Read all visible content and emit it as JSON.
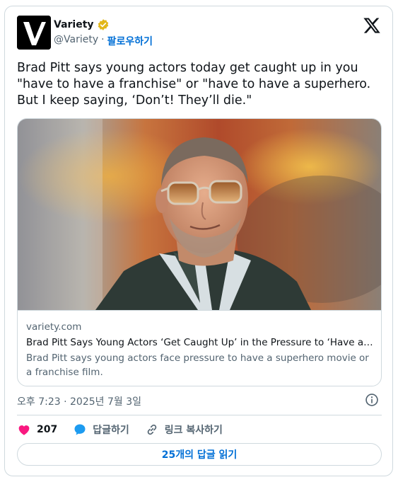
{
  "author": {
    "display_name": "Variety",
    "handle": "@Variety",
    "separator": "·",
    "follow_label": "팔로우하기",
    "avatar_icon": "variety-logo-icon",
    "verified_color": "#e2b719"
  },
  "tweet": {
    "text": "Brad Pitt says young actors today get caught up in you\n\"have to have a franchise\" or \"have to have a superhero.\nBut I keep saying, ‘Don’t! They’ll die.\""
  },
  "link_card": {
    "image_icon": "photo-brad-pitt",
    "domain": "variety.com",
    "title": "Brad Pitt Says Young Actors ‘Get Caught Up’ in the Pressure to ‘Have a Superhero Movie’ or a Franchise Film",
    "description": "Brad Pitt says young actors face pressure to have a superhero movie or a franchise film."
  },
  "timestamp": "오후 7:23 · 2025년 7월 3일",
  "actions": {
    "like_count": "207",
    "reply_label": "답글하기",
    "copy_link_label": "링크 복사하기",
    "like_color": "#f91880",
    "reply_color": "#1d9bf0"
  },
  "replies_button": {
    "label": "25개의 답글 읽기"
  },
  "brand": {
    "x_icon": "x-logo-icon"
  }
}
